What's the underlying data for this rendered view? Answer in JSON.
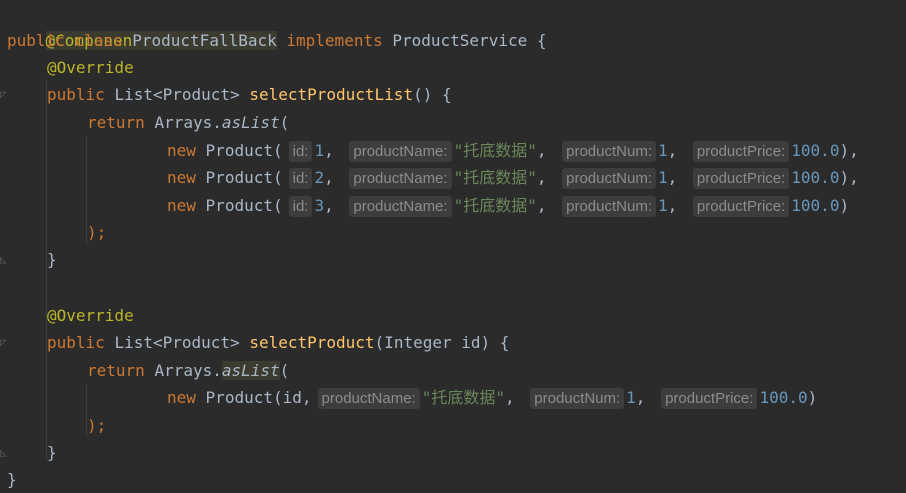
{
  "lines": {
    "l1": {
      "a": "@Component"
    },
    "l2": {
      "kw1": "public",
      "kw2": "class",
      "cls": "ProductFallBack",
      "kw3": "implements",
      "iface": "ProductService",
      "brace": " {"
    },
    "l3": {
      "a": "@Override"
    },
    "l4": {
      "kw": "public",
      "type": "List<Product>",
      "fn": "selectProductList",
      "rest": "() {"
    },
    "l5": {
      "kw": "return",
      "obj": "Arrays.",
      "m": "asList",
      "p": "("
    },
    "p1": {
      "new": "new",
      "ctor": "Product(",
      "h1": "id:",
      "v1": "1",
      "h2": "productName:",
      "v2": "\"托底数据\"",
      "h3": "productNum:",
      "v3": "1",
      "h4": "productPrice:",
      "v4": "100.0",
      "end": "),"
    },
    "p2": {
      "new": "new",
      "ctor": "Product(",
      "h1": "id:",
      "v1": "2",
      "h2": "productName:",
      "v2": "\"托底数据\"",
      "h3": "productNum:",
      "v3": "1",
      "h4": "productPrice:",
      "v4": "100.0",
      "end": "),"
    },
    "p3": {
      "new": "new",
      "ctor": "Product(",
      "h1": "id:",
      "v1": "3",
      "h2": "productName:",
      "v2": "\"托底数据\"",
      "h3": "productNum:",
      "v3": "1",
      "h4": "productPrice:",
      "v4": "100.0",
      "end": ")"
    },
    "l9": {
      "t": ");"
    },
    "l10": {
      "t": "}"
    },
    "l12": {
      "a": "@Override"
    },
    "l13": {
      "kw": "public",
      "type": "List<Product>",
      "fn": "selectProduct",
      "rest": "(Integer id) {"
    },
    "l14": {
      "kw": "return",
      "obj": "Arrays.",
      "m": "asList",
      "p": "("
    },
    "l15": {
      "new": "new",
      "ctor": "Product(id,",
      "h2": "productName:",
      "v2": "\"托底数据\"",
      "h3": "productNum:",
      "v3": "1",
      "h4": "productPrice:",
      "v4": "100.0",
      "end": ")"
    },
    "l16": {
      "t": ");"
    },
    "l17": {
      "t": "}"
    },
    "l18": {
      "t": "}"
    }
  },
  "colors": {
    "background": "#2b2b2b",
    "keyword": "#cc7832",
    "annotation": "#bbb529",
    "number": "#6897bb",
    "string": "#6a8759",
    "method": "#ffc66d"
  }
}
